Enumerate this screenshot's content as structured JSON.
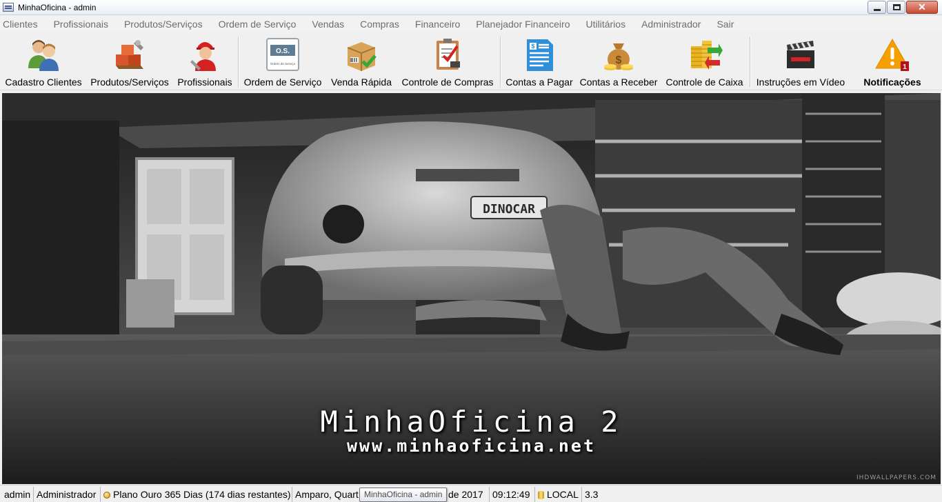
{
  "window": {
    "title": "MinhaOficina - admin",
    "close_glyph": "✕"
  },
  "menu": [
    "Clientes",
    "Profissionais",
    "Produtos/Serviços",
    "Ordem de Serviço",
    "Vendas",
    "Compras",
    "Financeiro",
    "Planejador Financeiro",
    "Utilitários",
    "Administrador",
    "Sair"
  ],
  "toolbar": {
    "cadastro_clientes": "Cadastro Clientes",
    "produtos_servicos": "Produtos/Serviços",
    "profissionais": "Profissionais",
    "ordem_servico": "Ordem de Serviço",
    "ordem_servico_badge": "O.S.",
    "ordem_servico_caption": "Ordem de Serviço",
    "venda_rapida": "Venda Rápida",
    "controle_compras": "Controle de Compras",
    "contas_pagar": "Contas a Pagar",
    "contas_receber": "Contas a Receber",
    "controle_caixa": "Controle de Caixa",
    "instrucoes_video": "Instruções em Vídeo",
    "notificacoes": "Notificações",
    "notification_count": "1"
  },
  "hero": {
    "title": "MinhaOficina 2",
    "url": "www.minhaoficina.net",
    "plate": "DINOCAR",
    "watermark": "IHDWALLPAPERS.COM"
  },
  "status": {
    "user": "admin",
    "role": "Administrador",
    "plan": "Plano Ouro 365 Dias (174 dias restantes)",
    "date_left": "Amparo, Quart",
    "date_right": "de 2017",
    "time": "09:12:49",
    "db": "LOCAL",
    "version": "3.3"
  },
  "tooltip": "MinhaOficina - admin",
  "colors": {
    "menu_text": "#6d6d6d",
    "notification": "#f5a000"
  }
}
